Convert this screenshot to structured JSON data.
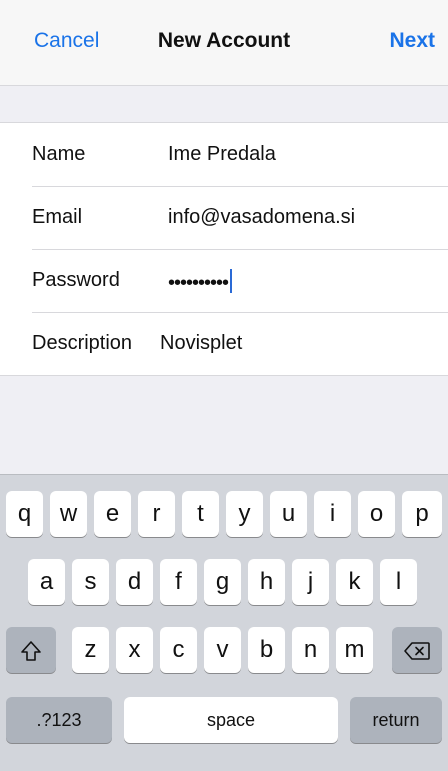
{
  "nav": {
    "cancel_label": "Cancel",
    "title": "New Account",
    "next_label": "Next"
  },
  "form": {
    "rows": [
      {
        "label": "Name",
        "value": "Ime Predala"
      },
      {
        "label": "Email",
        "value": "info@vasadomena.si"
      },
      {
        "label": "Password",
        "value": "••••••••••"
      },
      {
        "label": "Description",
        "value": "Novisplet"
      }
    ]
  },
  "keyboard": {
    "row1": [
      "q",
      "w",
      "e",
      "r",
      "t",
      "y",
      "u",
      "i",
      "o",
      "p"
    ],
    "row2": [
      "a",
      "s",
      "d",
      "f",
      "g",
      "h",
      "j",
      "k",
      "l"
    ],
    "row3": [
      "z",
      "x",
      "c",
      "v",
      "b",
      "n",
      "m"
    ],
    "shift_icon": "shift-arrow-icon",
    "delete_icon": "delete-backspace-icon",
    "numbers_label": ".?123",
    "space_label": "space",
    "return_label": "return"
  },
  "colors": {
    "accent": "#1a73e8",
    "caret": "#2a6ad6",
    "keyboard_bg": "#d2d5db",
    "key_dark": "#adb3bc"
  }
}
